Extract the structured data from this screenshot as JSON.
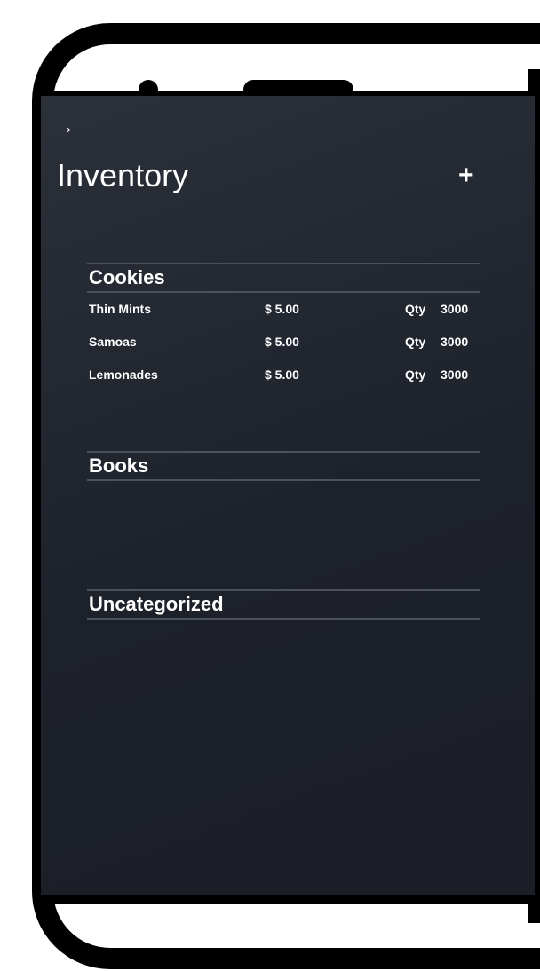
{
  "header": {
    "back_icon": "→",
    "title": "Inventory",
    "add_icon": "+"
  },
  "sections": [
    {
      "title": "Cookies",
      "items": [
        {
          "name": "Thin Mints",
          "price": "$ 5.00",
          "qty_label": "Qty",
          "qty": "3000"
        },
        {
          "name": "Samoas",
          "price": "$ 5.00",
          "qty_label": "Qty",
          "qty": "3000"
        },
        {
          "name": "Lemonades",
          "price": "$ 5.00",
          "qty_label": "Qty",
          "qty": "3000"
        }
      ]
    },
    {
      "title": "Books",
      "items": []
    },
    {
      "title": "Uncategorized",
      "items": []
    }
  ],
  "colors": {
    "screen_background": "#1e222b",
    "divider": "#4b505a",
    "text": "#ffffff",
    "bezel": "#000000"
  }
}
